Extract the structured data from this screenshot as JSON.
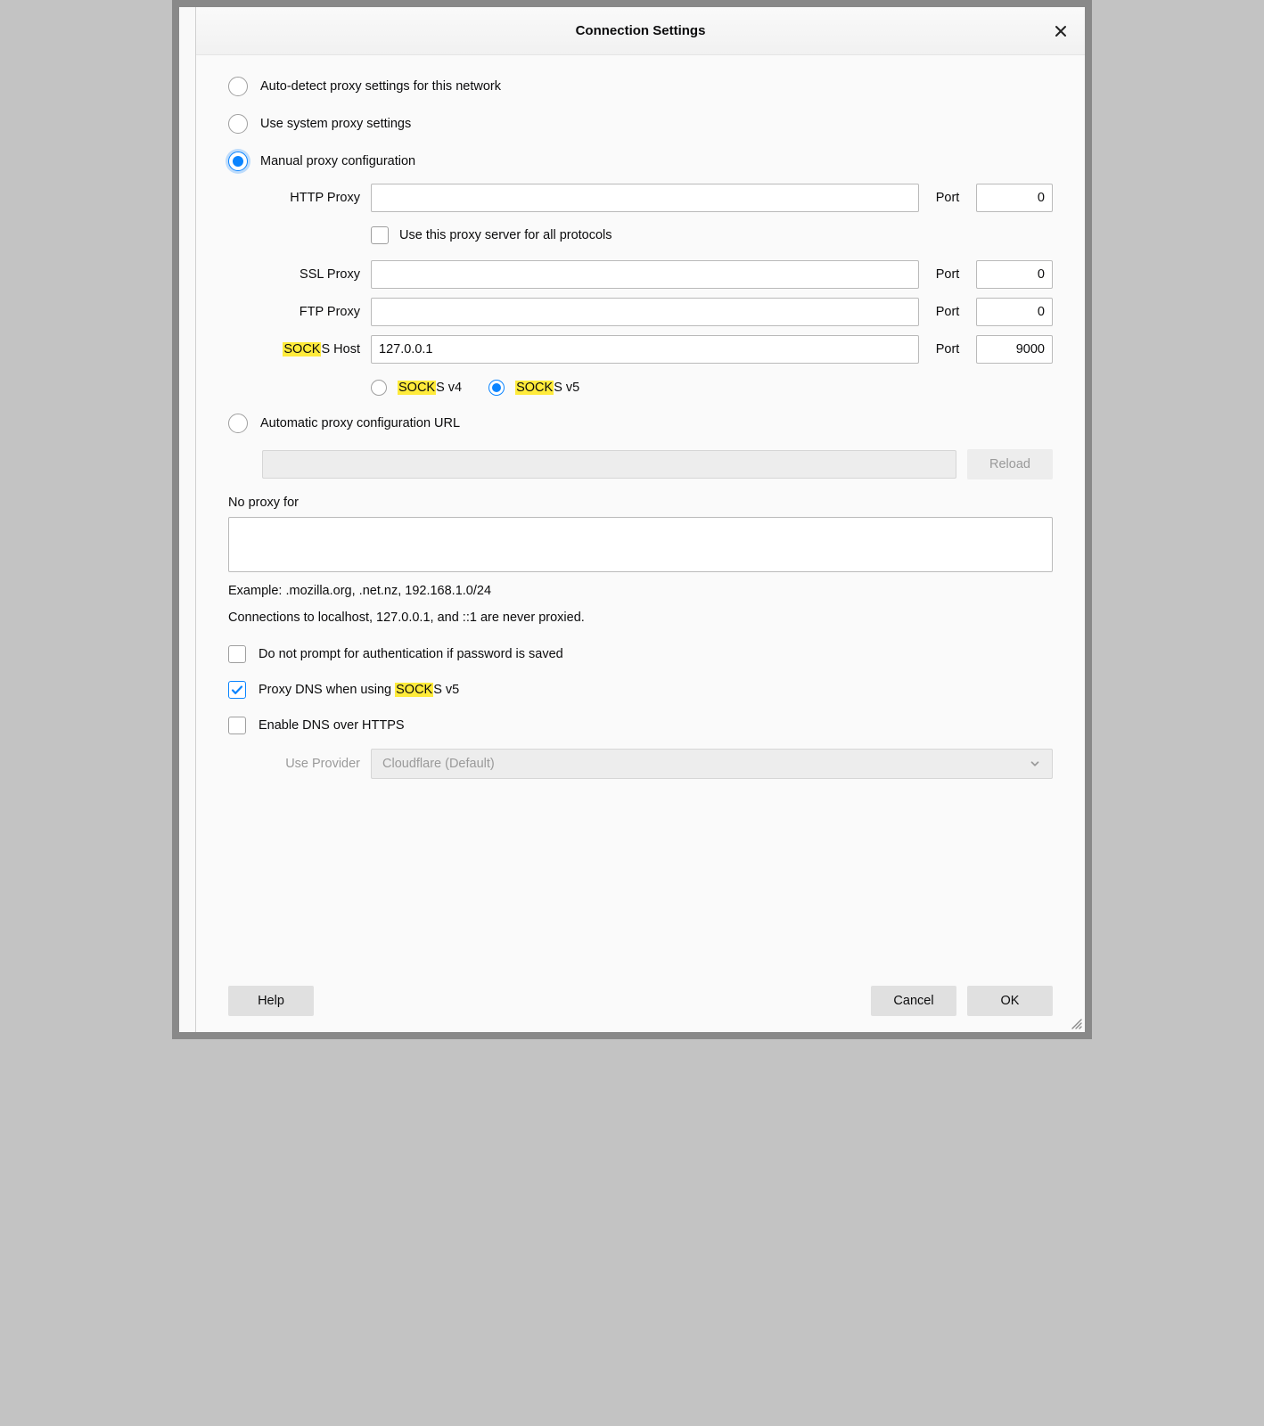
{
  "dialog": {
    "title": "Connection Settings",
    "close_aria": "Close"
  },
  "radios": {
    "auto_detect": "Auto-detect proxy settings for this network",
    "system": "Use system proxy settings",
    "manual": "Manual proxy configuration",
    "pac": "Automatic proxy configuration URL",
    "selected": "manual"
  },
  "proxy": {
    "http_label": "HTTP Proxy",
    "http_value": "",
    "http_port": "0",
    "ssl_label": "SSL Proxy",
    "ssl_value": "",
    "ssl_port": "0",
    "ftp_label": "FTP Proxy",
    "ftp_value": "",
    "ftp_port": "0",
    "socks_label_pre": "SOCK",
    "socks_label_post": "S Host",
    "socks_value": "127.0.0.1",
    "socks_port": "9000",
    "port_label": "Port",
    "all_protocols": "Use this proxy server for all protocols",
    "socks_v4_pre": "SOCK",
    "socks_v4_post": "S v4",
    "socks_v5_pre": "SOCK",
    "socks_v5_post": "S v5",
    "socks_version_selected": "v5"
  },
  "pac": {
    "url_value": "",
    "reload": "Reload"
  },
  "noproxy": {
    "label": "No proxy for",
    "value": "",
    "example": "Example: .mozilla.org, .net.nz, 192.168.1.0/24",
    "localhost_note": "Connections to localhost, 127.0.0.1, and ::1 are never proxied."
  },
  "checks": {
    "no_prompt": {
      "label": "Do not prompt for authentication if password is saved",
      "checked": false
    },
    "proxy_dns_pre": "Proxy DNS when using ",
    "proxy_dns_hl": "SOCK",
    "proxy_dns_post": "S v5",
    "proxy_dns_checked": true,
    "enable_doh": {
      "label": "Enable DNS over HTTPS",
      "checked": false
    }
  },
  "provider": {
    "label": "Use Provider",
    "selected": "Cloudflare (Default)"
  },
  "buttons": {
    "help": "Help",
    "cancel": "Cancel",
    "ok": "OK"
  },
  "peek_lines": [
    "s",
    "tt",
    "w"
  ]
}
